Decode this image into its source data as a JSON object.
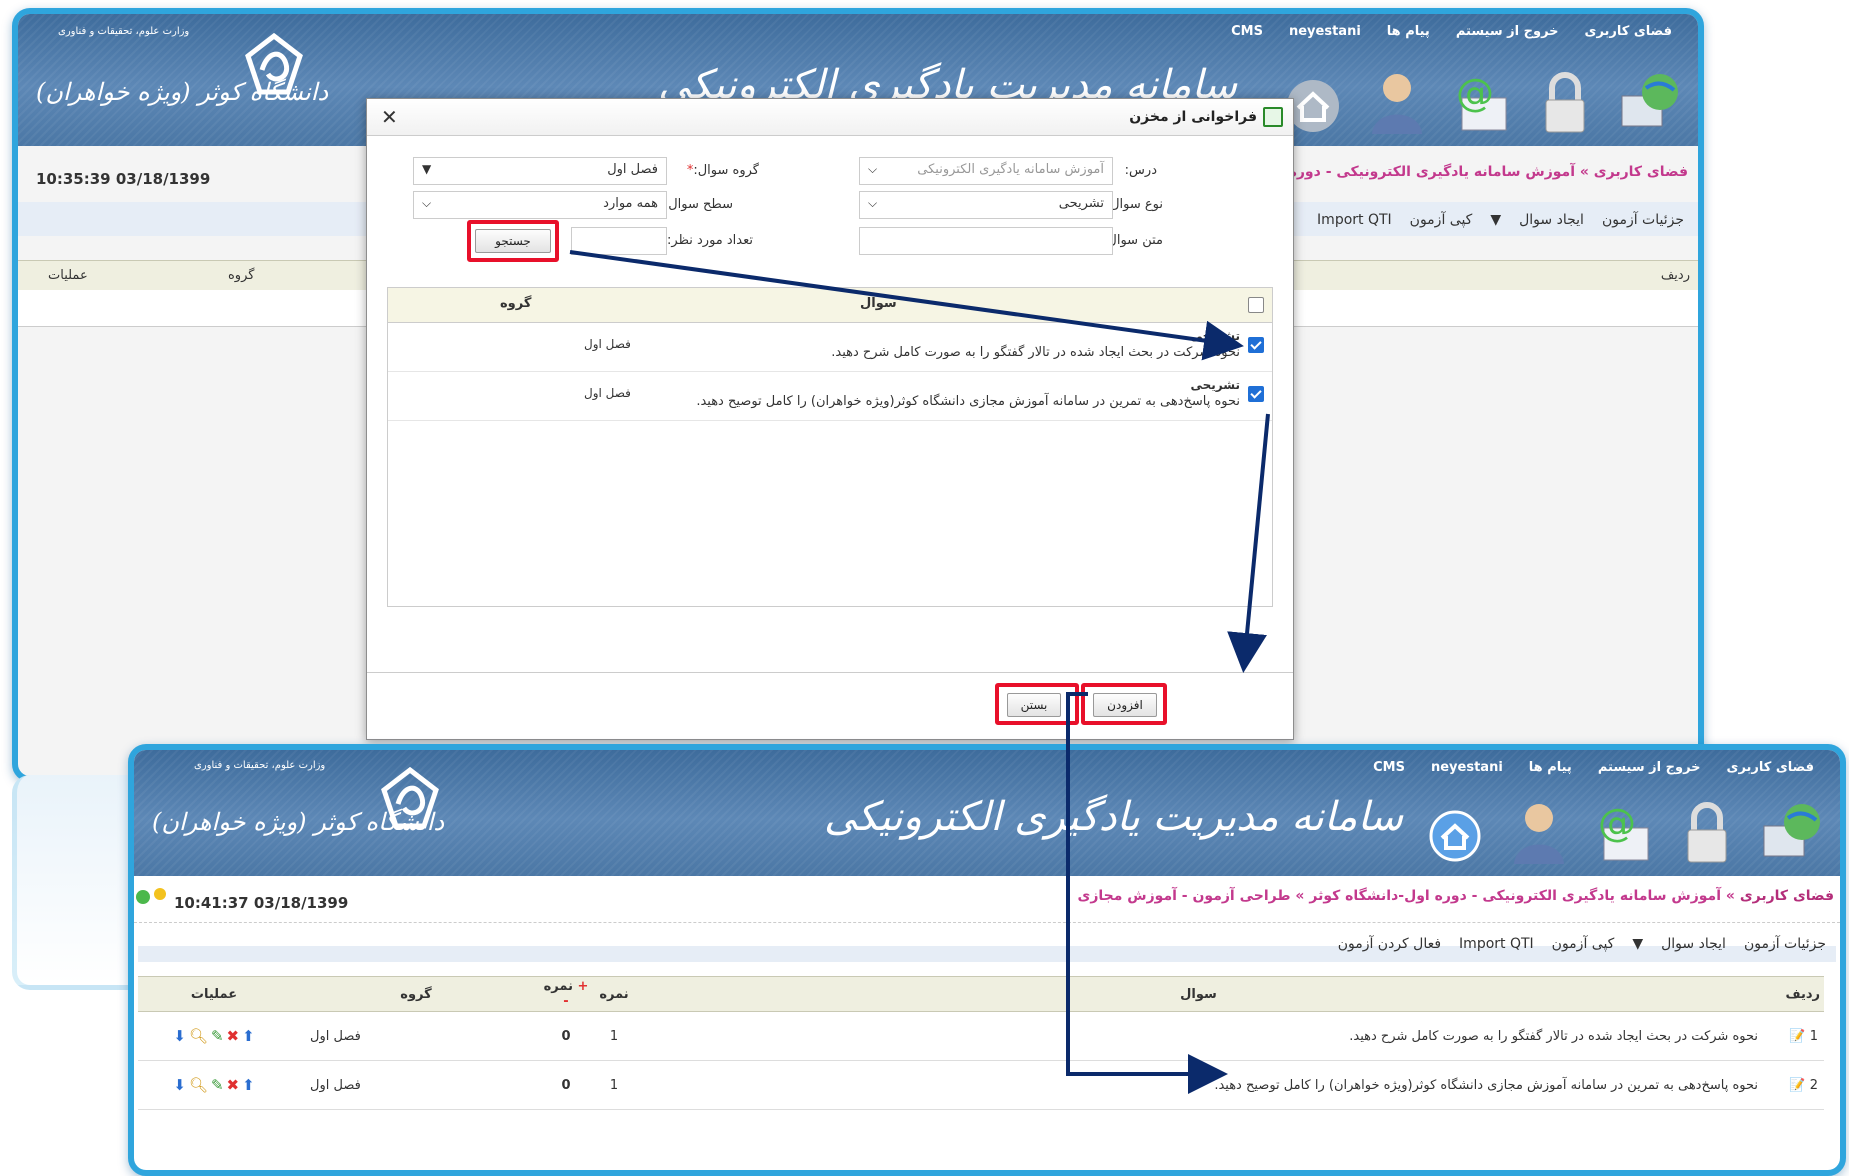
{
  "header": {
    "top_links": [
      "فضای کاربری",
      "خروج از سیستم",
      "پیام ها",
      "neyestani",
      "CMS"
    ],
    "banner": "سامانه مدیریت یادگیری الکترونیکی",
    "university": "دانشگاه کوثر (ویژه خواهران)",
    "ministry": "وزارت علوم، تحقیقات و فناوری",
    "icons": [
      "globe-icon",
      "lock-icon",
      "email-icon",
      "user-icon",
      "home-icon"
    ]
  },
  "back_window": {
    "clock": "10:35:39 03/18/1399",
    "breadcrumb": "فضای کاربری » آموزش سامانه یادگیری الکترونیکی - دوره",
    "toolbar": [
      "جزئیات آزمون",
      "ایجاد سوال",
      "کپی آزمون",
      "Import QTI"
    ],
    "col_row": "ردیف",
    "col_group": "گروه",
    "col_ops": "عملیات"
  },
  "modal": {
    "title": "فراخوانی از مخزن",
    "course_label": "درس:",
    "course_value": "آموزش سامانه یادگیری الکترونیکی",
    "group_label": "گروه سوال:",
    "group_value": "فصل اول",
    "type_label": "نوع سوال:",
    "type_value": "تشریحی",
    "level_label": "سطح سوال:",
    "level_value": "همه موارد",
    "text_label": "متن سوال:",
    "count_label": "تعداد مورد نظر:",
    "search_button": "جستجو",
    "col_question": "سوال",
    "col_group": "گروه",
    "rows": [
      {
        "type": "تشریحی",
        "text": "نحوه شرکت در بحث ایجاد شده در تالار گفتگو را به صورت کامل شرح دهید.",
        "group": "فصل اول",
        "checked": true
      },
      {
        "type": "تشریحی",
        "text": "نحوه پاسخ‌دهی به تمرین در سامانه آموزش مجازی دانشگاه کوثر(ویژه خواهران) را کامل توصیح دهید.",
        "group": "فصل اول",
        "checked": true
      }
    ],
    "add_button": "افزودن",
    "close_button": "بستن"
  },
  "front_window": {
    "clock": "10:41:37 03/18/1399",
    "breadcrumb_1": "فضای کاربری",
    "breadcrumb_2": "آموزش سامانه یادگیری الکترونیکی - دوره اول-دانشگاه کوثر",
    "breadcrumb_3": "طراحی آزمون - آموزش مجازی",
    "toolbar": [
      "جزئیات آزمون",
      "ایجاد سوال",
      "کپی آزمون",
      "Import QTI",
      "فعال کردن آزمون"
    ],
    "columns": {
      "row": "ردیف",
      "question": "سوال",
      "score": "نمره",
      "plus": "+",
      "score2": "نمره",
      "minus": "-",
      "group": "گروه",
      "ops": "عملیات"
    },
    "rows": [
      {
        "num": "1",
        "text": "نحوه شرکت در بحث ایجاد شده در تالار گفتگو را به صورت کامل شرح دهید.",
        "score": "1",
        "neg": "0",
        "group": "فصل اول"
      },
      {
        "num": "2",
        "text": "نحوه پاسخ‌دهی به تمرین در سامانه آموزش مجازی دانشگاه کوثر(ویژه خواهران) را کامل توصیح دهید.",
        "score": "1",
        "neg": "0",
        "group": "فصل اول"
      }
    ]
  },
  "colors": {
    "frame": "#2fa5dd",
    "header": "#4b77a5",
    "highlight": "#e8102a",
    "arrow": "#0b2a6b",
    "breadcrumb": "#c3398d"
  }
}
